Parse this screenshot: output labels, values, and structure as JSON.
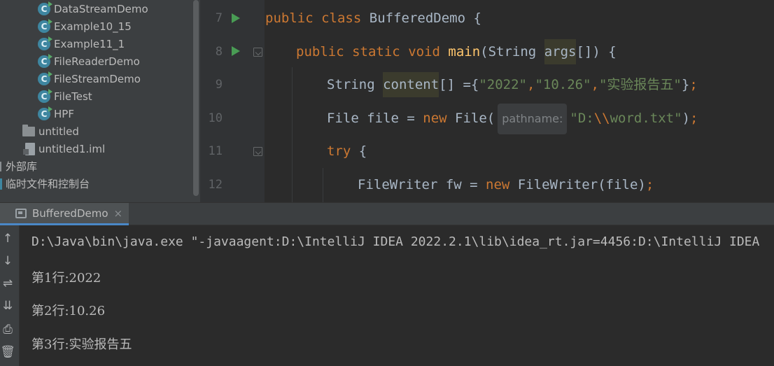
{
  "project_tree": {
    "items": [
      {
        "label": "DataStreamDemo",
        "icon": "java-class-icon"
      },
      {
        "label": "Example10_15",
        "icon": "java-class-icon"
      },
      {
        "label": "Example11_1",
        "icon": "java-class-icon"
      },
      {
        "label": "FileReaderDemo",
        "icon": "java-class-icon"
      },
      {
        "label": "FileStreamDemo",
        "icon": "java-class-icon"
      },
      {
        "label": "FileTest",
        "icon": "java-class-icon"
      },
      {
        "label": "HPF",
        "icon": "java-class-icon"
      },
      {
        "label": "untitled",
        "icon": "folder-icon"
      },
      {
        "label": "untitled1.iml",
        "icon": "module-file-icon"
      },
      {
        "label": "外部库",
        "icon": "library-icon"
      },
      {
        "label": "临时文件和控制台",
        "icon": "scratch-icon"
      }
    ]
  },
  "editor": {
    "line_numbers": [
      "7",
      "8",
      "9",
      "10",
      "11",
      "12"
    ],
    "line7": {
      "kw1": "public",
      "kw2": "class",
      "name": "BufferedDemo",
      "brace": "{"
    },
    "line8": {
      "kw1": "public",
      "kw2": "static",
      "kw3": "void",
      "fn": "main",
      "p1": "(String ",
      "arg": "args",
      "p2": "[]) {"
    },
    "line9": {
      "type": "String ",
      "var": "content",
      "p1": "[] ={",
      "s1": "\"2022\"",
      "c1": ",",
      "s2": "\"10.26\"",
      "c2": ",",
      "s3": "\"实验报告五\"",
      "p2": "}",
      "semi": ";"
    },
    "line10": {
      "p1": "File file = ",
      "kw": "new",
      "p2": " File(",
      "hint": "pathname:",
      "s1": "\"D:",
      "esc": "\\\\",
      "s2": "word.txt\"",
      "p3": ")",
      "semi": ";"
    },
    "line11": {
      "kw": "try",
      "p1": " {"
    },
    "line12": {
      "p1": "FileWriter fw = ",
      "kw": "new",
      "p2": " FileWriter(file)",
      "semi": ";"
    }
  },
  "run_panel": {
    "tab_label": "BufferedDemo",
    "tab_close": "×",
    "toolbar": [
      "↑",
      "↓",
      "⇌",
      "⇊",
      "⎙",
      "🗑"
    ],
    "console_lines": [
      "D:\\Java\\bin\\java.exe \"-javaagent:D:\\IntelliJ IDEA 2022.2.1\\lib\\idea_rt.jar=4456:D:\\IntelliJ IDEA",
      "第1行:2022",
      "第2行:10.26",
      "第3行:实验报告五"
    ]
  },
  "colors": {
    "keyword": "#cc7832",
    "function": "#ffc66d",
    "string": "#6a8759",
    "text": "#a9b7c6",
    "run_arrow": "#499c54",
    "tab_underline": "#4a88c7"
  }
}
